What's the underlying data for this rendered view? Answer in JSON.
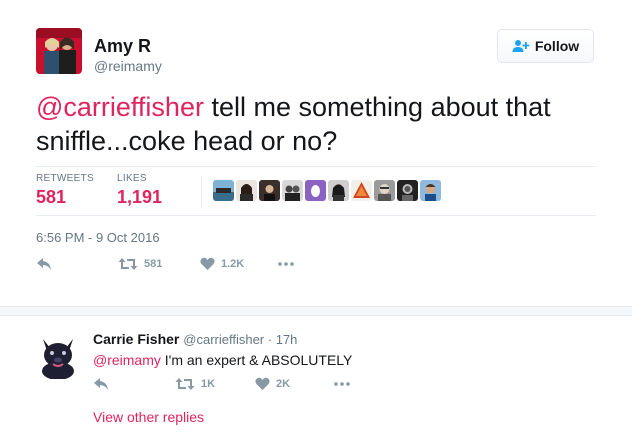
{
  "tweet": {
    "author_name": "Amy R",
    "author_handle": "@reimamy",
    "follow_label": "Follow",
    "mention": "@carrieffisher",
    "text_rest": " tell me something about that sniffle...coke head or no?",
    "stats": {
      "retweets_label": "RETWEETS",
      "retweets_value": "581",
      "likes_label": "LIKES",
      "likes_value": "1,191"
    },
    "timestamp": "6:56 PM - 9 Oct 2016",
    "actions": {
      "retweet_count": "581",
      "like_count": "1.2K"
    }
  },
  "reply": {
    "author_name": "Carrie Fisher",
    "meta": "@carrieffisher · 17h",
    "mention": "@reimamy",
    "text_rest": " I'm an expert & ABSOLUTELY",
    "actions": {
      "retweet_count": "1K",
      "like_count": "2K"
    },
    "view_replies_label": "View other replies"
  },
  "colors": {
    "accent": "#e0245e",
    "muted": "#657786",
    "icon": "#8899a6",
    "divider": "#e6ecf0"
  },
  "icons": [
    "follow-person-plus-icon",
    "reply-arrow-icon",
    "retweet-icon",
    "heart-icon",
    "more-dots-icon"
  ]
}
